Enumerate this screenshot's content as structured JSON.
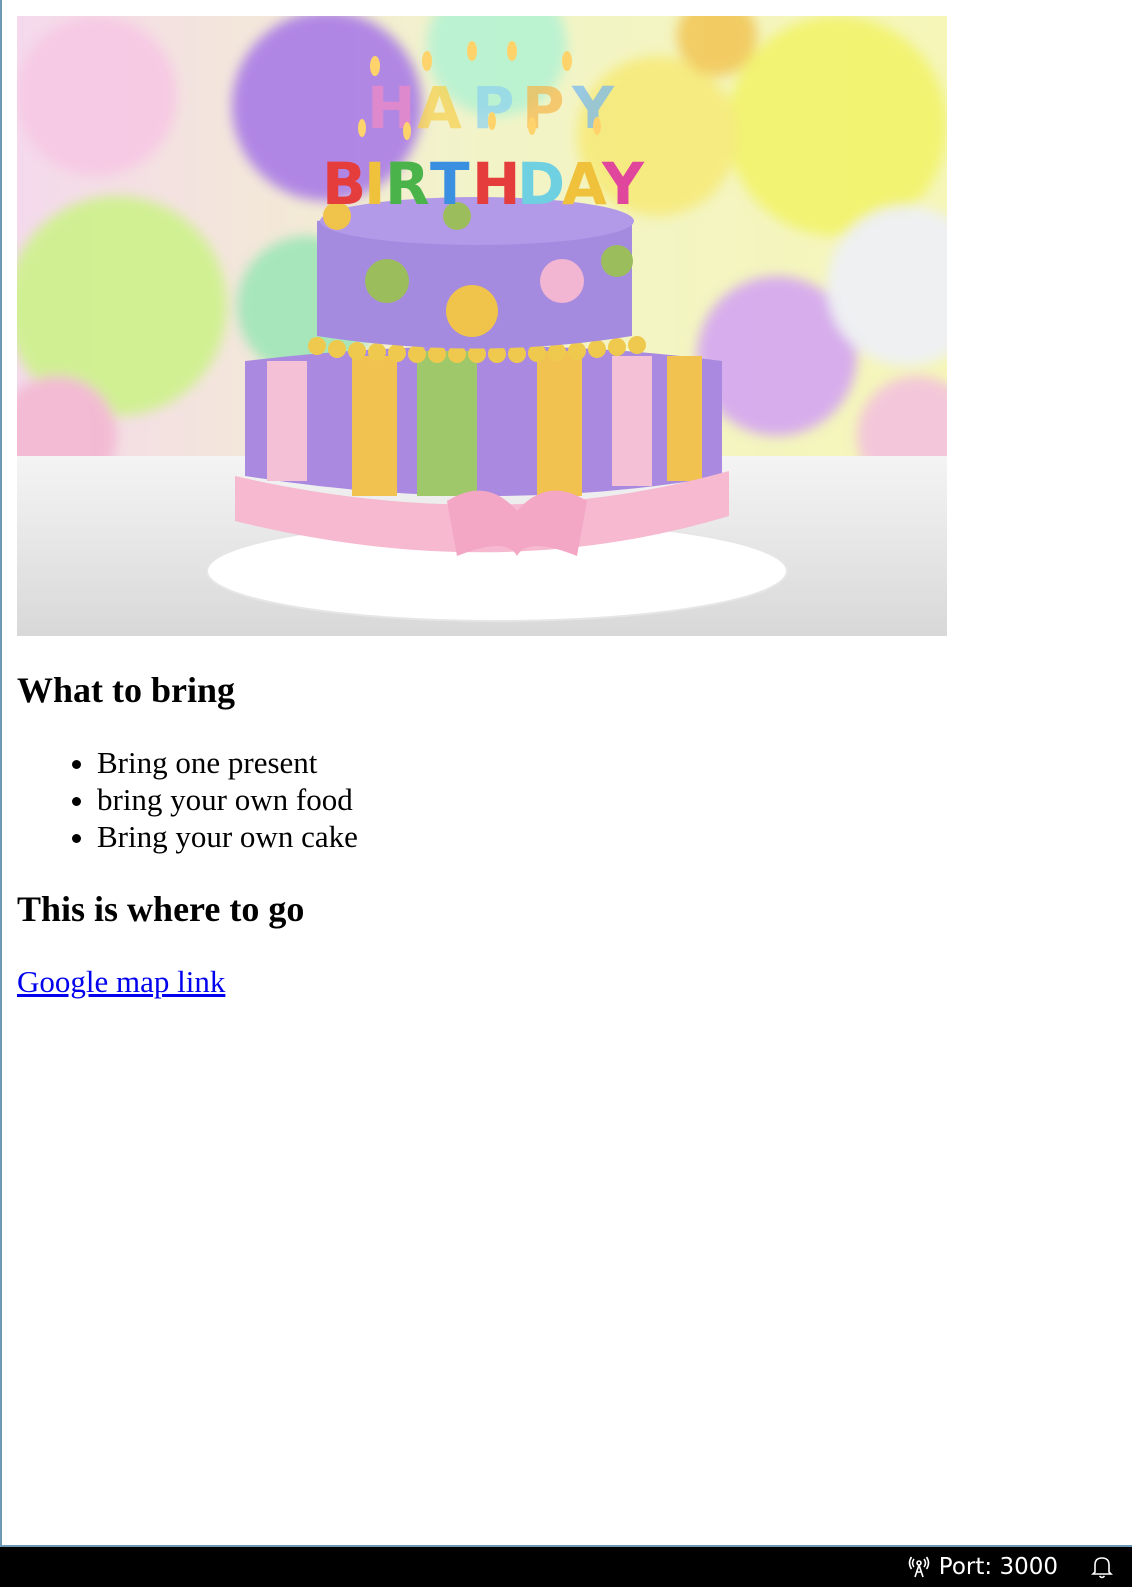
{
  "image": {
    "alt": "",
    "icon": "birthday-cake-image"
  },
  "sections": {
    "bring": {
      "heading": "What to bring",
      "items": [
        "Bring one present",
        "bring your own food",
        "Bring your own cake"
      ]
    },
    "go": {
      "heading": "This is where to go",
      "link_text": "Google map link"
    }
  },
  "status_bar": {
    "port_label": "Port: 3000",
    "port_icon": "broadcast-icon",
    "bell_icon": "bell-icon"
  },
  "colors": {
    "link": "#0000ee",
    "status_bg": "#000000",
    "status_border": "#6b98b5"
  }
}
